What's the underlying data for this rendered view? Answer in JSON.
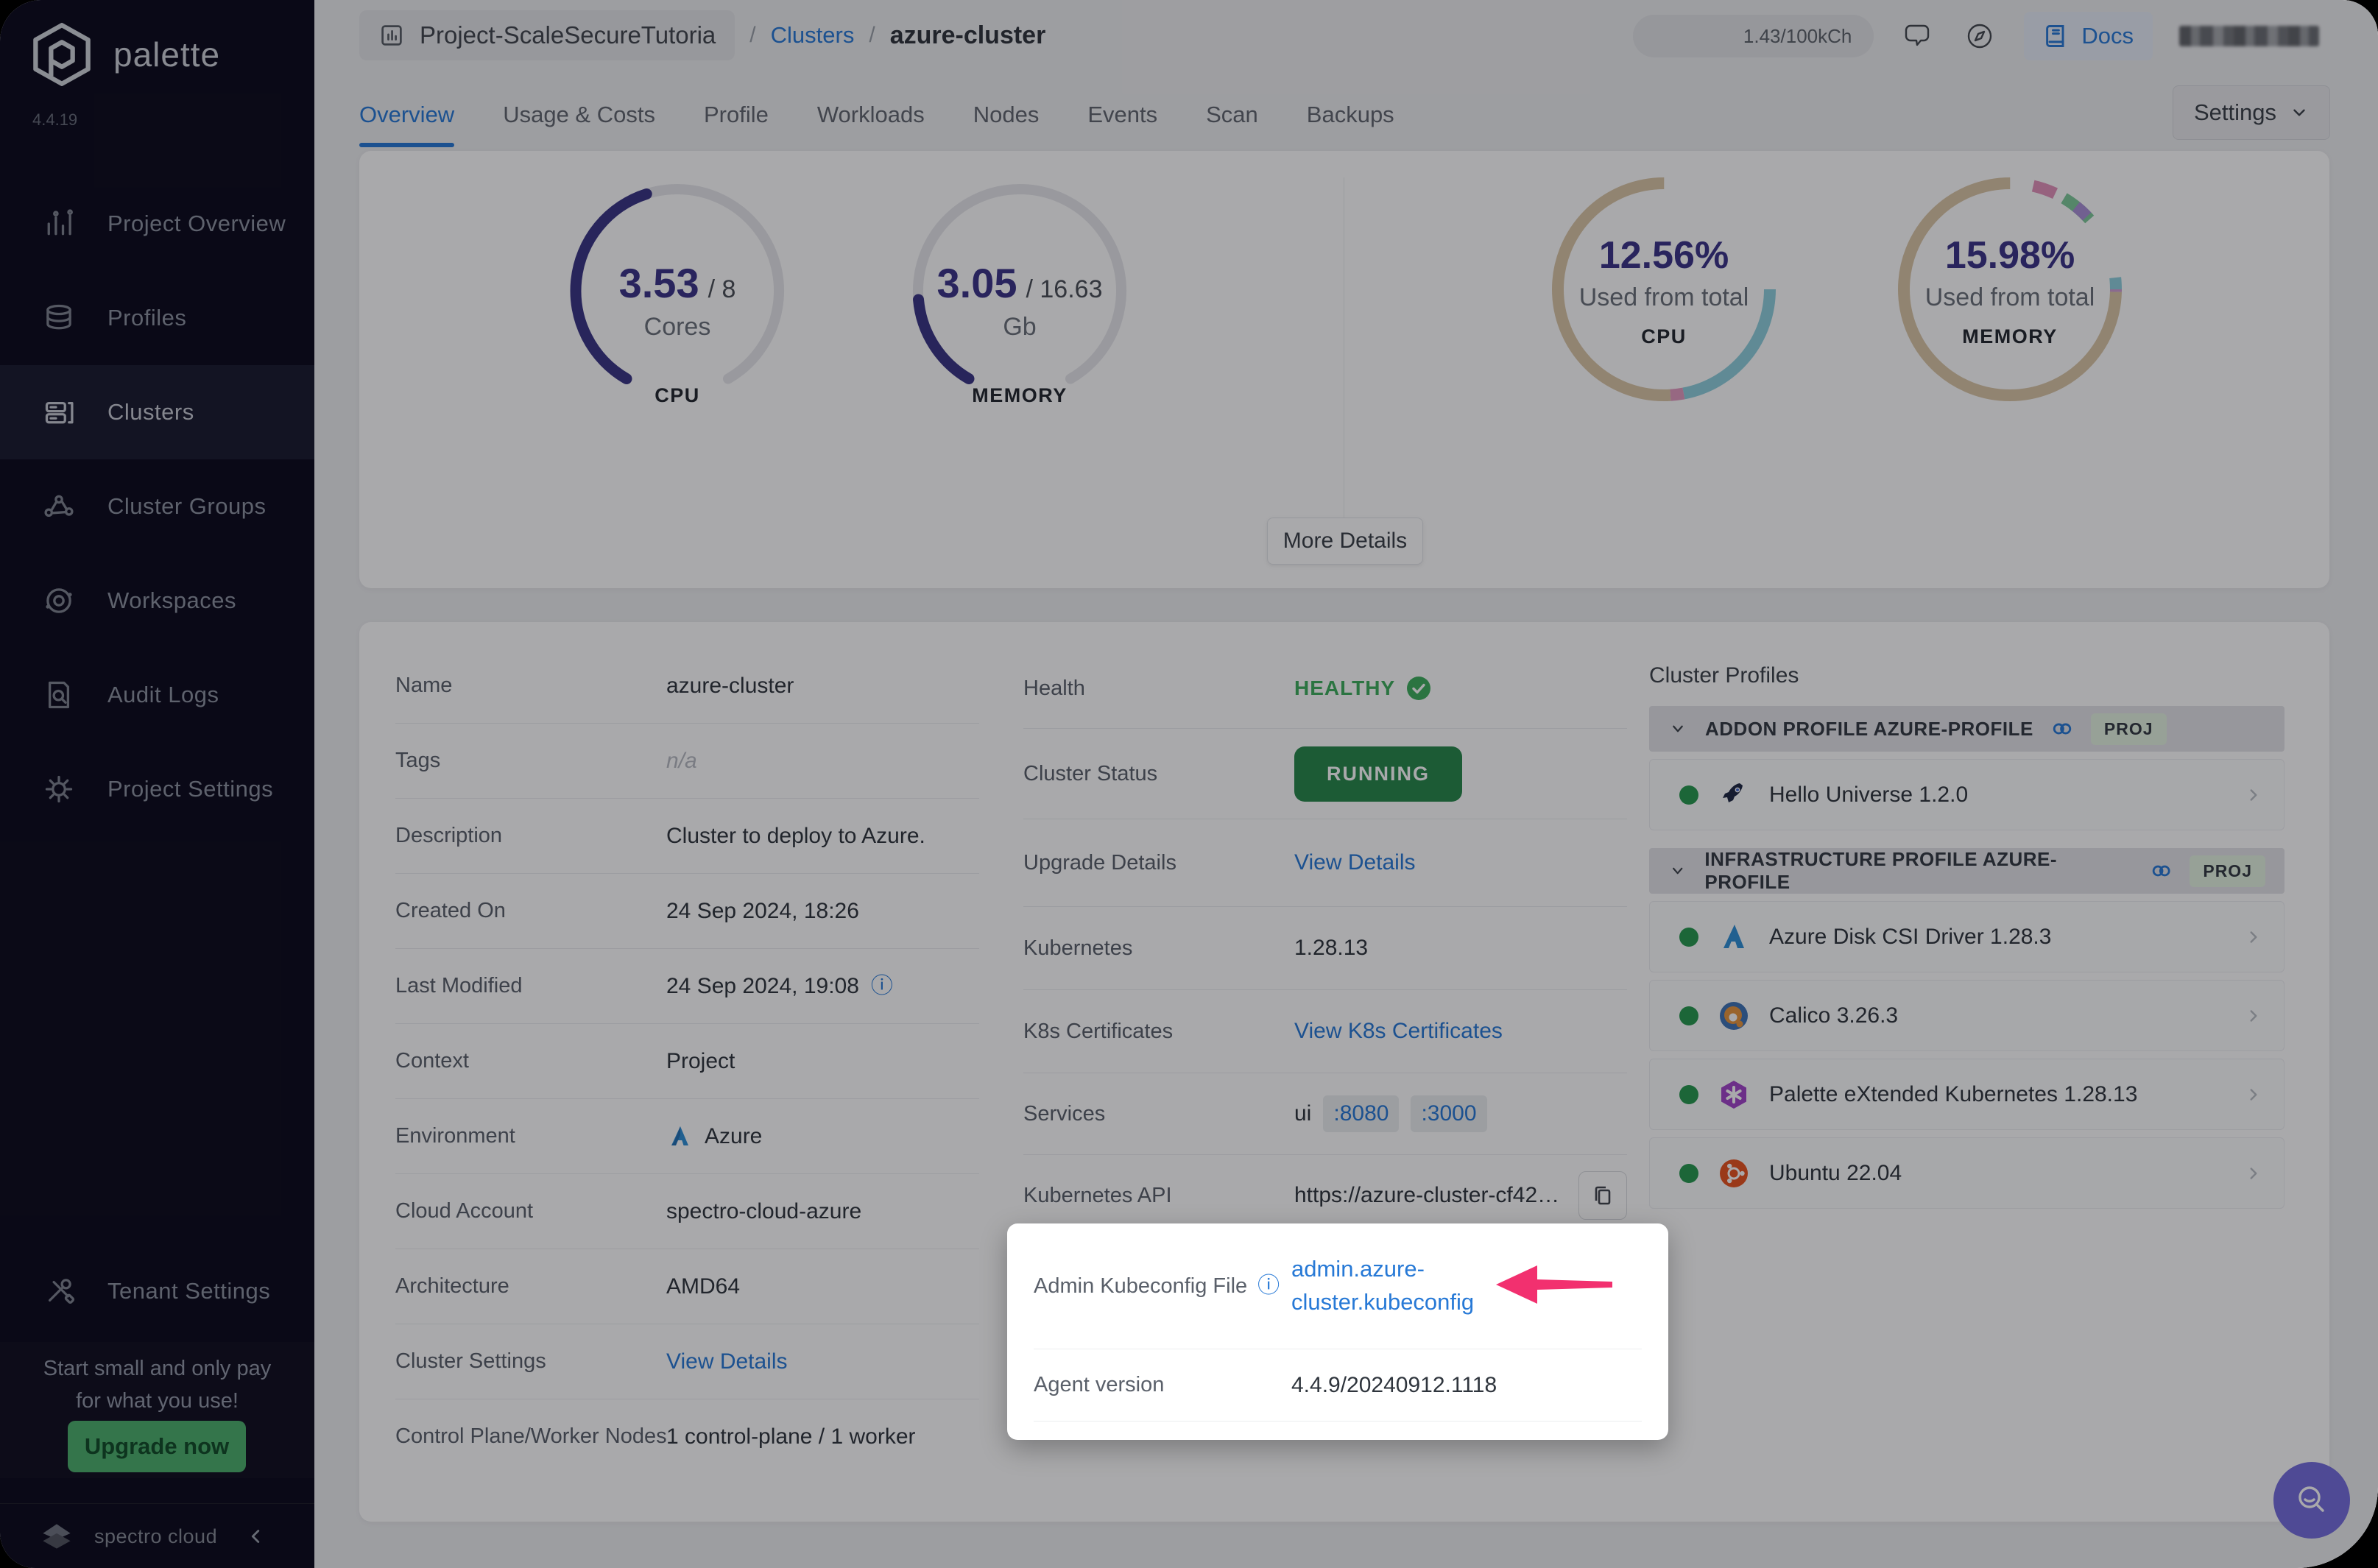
{
  "brand": {
    "name": "palette",
    "version": "4.4.19",
    "footer": "spectro cloud"
  },
  "sidebar": {
    "items": [
      {
        "label": "Project Overview"
      },
      {
        "label": "Profiles"
      },
      {
        "label": "Clusters"
      },
      {
        "label": "Cluster Groups"
      },
      {
        "label": "Workspaces"
      },
      {
        "label": "Audit Logs"
      },
      {
        "label": "Project Settings"
      }
    ],
    "tenant_settings": "Tenant Settings",
    "promo": {
      "line1": "Start small and only pay",
      "line2": "for what you use!",
      "button": "Upgrade now"
    }
  },
  "topbar": {
    "breadcrumb": {
      "project": "Project-ScaleSecureTutoria",
      "sep": "/",
      "section": "Clusters",
      "current": "azure-cluster"
    },
    "credits": "1.43/100kCh",
    "docs": "Docs"
  },
  "tabs": [
    {
      "label": "Overview"
    },
    {
      "label": "Usage & Costs"
    },
    {
      "label": "Profile"
    },
    {
      "label": "Workloads"
    },
    {
      "label": "Nodes"
    },
    {
      "label": "Events"
    },
    {
      "label": "Scan"
    },
    {
      "label": "Backups"
    }
  ],
  "settings_button": "Settings",
  "overview": {
    "more_details": "More Details"
  },
  "chart_data": [
    {
      "type": "gauge",
      "label": "CPU",
      "value": 3.53,
      "total": 8,
      "value_display": "3.53",
      "total_display": "/ 8",
      "unit": "Cores",
      "fill_color": "#3a3585",
      "track_color": "#e6e7eb",
      "arc_degrees": 300
    },
    {
      "type": "gauge",
      "label": "MEMORY",
      "value": 3.05,
      "total": 16.63,
      "value_display": "3.05",
      "total_display": "/ 16.63",
      "unit": "Gb",
      "fill_color": "#3a3585",
      "track_color": "#e6e7eb",
      "arc_degrees": 300
    },
    {
      "type": "donut",
      "label": "CPU",
      "value_display": "12.56%",
      "used_pct": 12.56,
      "caption": "Used from total",
      "segments": [
        {
          "color": "#8fd0dd",
          "frac": 0.47
        },
        {
          "color": "#e39cc0",
          "frac": 0.02
        },
        {
          "color": "#dbc6a6",
          "frac": 0.51
        }
      ]
    },
    {
      "type": "donut",
      "label": "MEMORY",
      "value_display": "15.98%",
      "used_pct": 15.98,
      "caption": "Used from total",
      "segments": [
        {
          "color": "#e292bb",
          "frac": 0.035
        },
        {
          "color": "#7ec99a",
          "frac": 0.05
        },
        {
          "color": "#a98fd6",
          "frac": 0.022
        },
        {
          "color": "#8fd0dd",
          "frac": 0.125
        },
        {
          "color": "#cf9ed3",
          "frac": 0.022
        },
        {
          "color": "#dbc6a6",
          "frac": 0.746
        }
      ]
    }
  ],
  "cluster_info": {
    "rows": [
      {
        "label": "Name",
        "value": "azure-cluster"
      },
      {
        "label": "Tags",
        "value": "n/a"
      },
      {
        "label": "Description",
        "value": "Cluster to deploy to Azure."
      },
      {
        "label": "Created On",
        "value": "24 Sep 2024, 18:26"
      },
      {
        "label": "Last Modified",
        "value": "24 Sep 2024, 19:08"
      },
      {
        "label": "Context",
        "value": "Project"
      },
      {
        "label": "Environment",
        "value": "Azure"
      },
      {
        "label": "Cloud Account",
        "value": "spectro-cloud-azure"
      },
      {
        "label": "Architecture",
        "value": "AMD64"
      },
      {
        "label": "Cluster Settings",
        "value": "View Details"
      },
      {
        "label": "Control Plane/Worker Nodes",
        "value": "1 control-plane / 1 worker"
      }
    ]
  },
  "status": {
    "health_label": "Health",
    "health_value": "HEALTHY",
    "cluster_status_label": "Cluster Status",
    "cluster_status_value": "RUNNING",
    "upgrade_label": "Upgrade Details",
    "upgrade_value": "View Details",
    "kubernetes_label": "Kubernetes",
    "kubernetes_value": "1.28.13",
    "certs_label": "K8s Certificates",
    "certs_value": "View K8s Certificates",
    "services_label": "Services",
    "services_name": "ui",
    "services_ports": [
      ":8080",
      ":3000"
    ],
    "api_label": "Kubernetes API",
    "api_value": "https://azure-cluster-cf42…"
  },
  "spotlight": {
    "kubeconfig_label": "Admin Kubeconfig File",
    "kubeconfig_value": "admin.azure-cluster.kubeconfig",
    "agent_label": "Agent version",
    "agent_value": "4.4.9/20240912.1118"
  },
  "profiles": {
    "title": "Cluster Profiles",
    "groups": [
      {
        "header": "ADDON PROFILE AZURE-PROFILE",
        "badge": "PROJ"
      },
      {
        "header": "INFRASTRUCTURE PROFILE AZURE-PROFILE",
        "badge": "PROJ"
      }
    ],
    "items": [
      {
        "name": "Hello Universe 1.2.0"
      },
      {
        "name": "Azure Disk CSI Driver 1.28.3"
      },
      {
        "name": "Calico 3.26.3"
      },
      {
        "name": "Palette eXtended Kubernetes 1.28.13"
      },
      {
        "name": "Ubuntu 22.04"
      }
    ]
  },
  "colors": {
    "accent_blue": "#2779d6",
    "healthy_green": "#3eae5c",
    "running_green": "#27874a",
    "gauge_indigo": "#3a3585",
    "arrow_pink": "#f2306f",
    "fab_purple": "#766ede",
    "sidebar_bg": "#0b0a1c",
    "upgrade_green": "#4cb06c"
  }
}
